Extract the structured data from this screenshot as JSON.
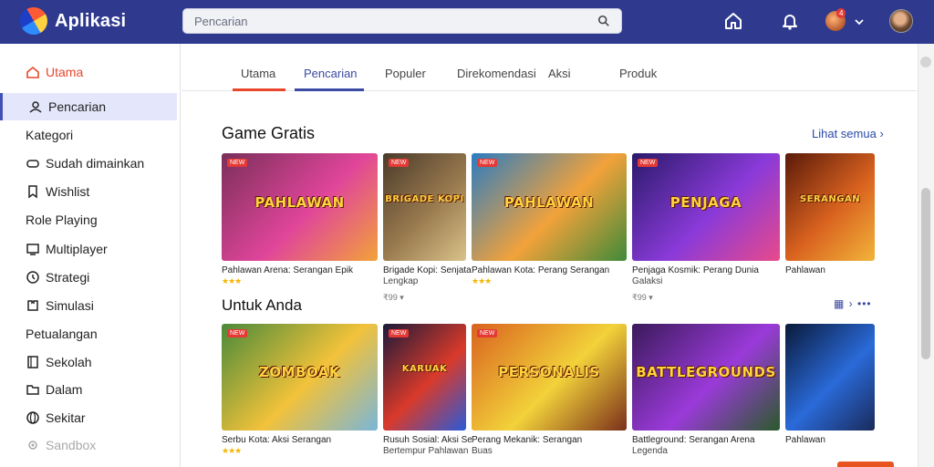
{
  "app": {
    "title": "Aplikasi"
  },
  "search": {
    "placeholder": "Pencarian"
  },
  "topbar": {
    "notification_count": "4"
  },
  "sidebar": {
    "items": [
      {
        "label": "Utama",
        "icon": "home-icon",
        "style": "active-red"
      },
      {
        "label": "Pencarian",
        "icon": "person-icon",
        "style": "selected"
      },
      {
        "label": "Kategori",
        "icon": "",
        "style": "head"
      },
      {
        "label": "Sudah dimainkan",
        "icon": "controller-icon",
        "style": ""
      },
      {
        "label": "Wishlist",
        "icon": "bookmark-icon",
        "style": ""
      },
      {
        "label": "Role Playing",
        "icon": "",
        "style": "head"
      },
      {
        "label": "Multiplayer",
        "icon": "monitor-icon",
        "style": ""
      },
      {
        "label": "Strategi",
        "icon": "clock-icon",
        "style": ""
      },
      {
        "label": "Simulasi",
        "icon": "puzzle-icon",
        "style": ""
      },
      {
        "label": "Petualangan",
        "icon": "",
        "style": "head"
      },
      {
        "label": "Sekolah",
        "icon": "book-icon",
        "style": ""
      },
      {
        "label": "Dalam",
        "icon": "folder-icon",
        "style": ""
      },
      {
        "label": "Sekitar",
        "icon": "globe-icon",
        "style": ""
      },
      {
        "label": "Sandbox",
        "icon": "gear-icon",
        "style": "dim"
      }
    ]
  },
  "tabs": [
    {
      "label": "Utama"
    },
    {
      "label": "Pencarian"
    },
    {
      "label": "Populer"
    },
    {
      "label": "Direkomendasi"
    },
    {
      "label": "Aksi"
    },
    {
      "label": "Produk"
    }
  ],
  "section1": {
    "title": "Game Gratis",
    "see_all": "Lihat semua",
    "cards": [
      {
        "art_text": "PAHLAWAN",
        "tag": "NEW",
        "title": "Pahlawan Arena: Serangan Epik",
        "stars": "★★★",
        "price": "",
        "colors": [
          "#7a2f5a",
          "#e0459a",
          "#f2a23a"
        ]
      },
      {
        "art_text": "BRIGADE KOPI",
        "tag": "NEW",
        "title": "Brigade Kopi: Senjata",
        "sub": "Lengkap",
        "stars": "",
        "price": "₹99 ▾",
        "colors": [
          "#4a3a2a",
          "#9a7b4f",
          "#d9c28a"
        ]
      },
      {
        "art_text": "PAHLAWAN",
        "tag": "NEW",
        "title": "Pahlawan Kota: Perang Serangan",
        "stars": "★★★",
        "price": "",
        "colors": [
          "#2a7cc2",
          "#f2a23a",
          "#3f8a3a"
        ]
      },
      {
        "art_text": "PENJAGA",
        "tag": "NEW",
        "title": "Penjaga Kosmik: Perang Dunia",
        "sub": "Galaksi",
        "stars": "",
        "price": "₹99 ▾",
        "colors": [
          "#2a1a6a",
          "#8a3ad9",
          "#e84a8a"
        ]
      },
      {
        "art_text": "SERANGAN",
        "tag": "",
        "title": "Pahlawan",
        "stars": "",
        "price": "",
        "colors": [
          "#5a1a0a",
          "#d9621f",
          "#f2b43a"
        ]
      }
    ]
  },
  "section2": {
    "title": "Untuk Anda",
    "cards": [
      {
        "art_text": "ZOMBOAK",
        "tag": "NEW",
        "title": "Serbu Kota: Aksi Serangan",
        "stars": "★★★",
        "price": "",
        "colors": [
          "#4a8a3a",
          "#f2c23a",
          "#7ab6d9"
        ]
      },
      {
        "art_text": "KARUAK",
        "tag": "NEW",
        "title": "Rusuh Sosial: Aksi Serangan",
        "sub": "Bertempur Pahlawan",
        "stars": "",
        "price": "",
        "colors": [
          "#1a1a3a",
          "#d93a2a",
          "#2a5ad9"
        ]
      },
      {
        "art_text": "PERSONALIS",
        "tag": "NEW",
        "title": "Perang Mekanik: Serangan",
        "sub": "Buas",
        "stars": "",
        "price": "",
        "colors": [
          "#d9621f",
          "#f2d23a",
          "#7a2f1a"
        ]
      },
      {
        "art_text": "BATTLEGROUNDS",
        "tag": "",
        "title": "Battleground: Serangan Arena",
        "sub": "Legenda",
        "stars": "",
        "price": "",
        "colors": [
          "#3a1a5a",
          "#9a3ad9",
          "#2a5a2a"
        ]
      },
      {
        "art_text": "",
        "tag": "",
        "title": "Pahlawan",
        "stars": "",
        "price": "",
        "colors": [
          "#0a1a3a",
          "#2a6ad9",
          "#1a2a5a"
        ]
      }
    ]
  },
  "colors": {
    "brand": "#2f3a8f",
    "accent": "#e8472b",
    "link": "#2a4aa8"
  }
}
